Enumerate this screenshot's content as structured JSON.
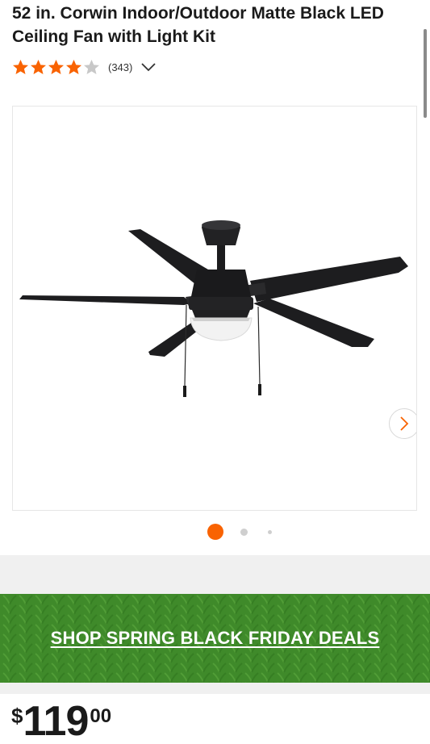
{
  "product": {
    "title": "52 in. Corwin Indoor/Outdoor Matte Black LED Ceiling Fan with Light Kit",
    "rating": 4,
    "max_rating": 5,
    "review_count": "(343)"
  },
  "gallery": {
    "active_slide": 1,
    "slide_count": 3,
    "image_icon": "ceiling-fan-product-image",
    "next_icon": "chevron-right-icon"
  },
  "promo": {
    "label": "SHOP SPRING BLACK FRIDAY DEALS",
    "background_color": "#3f8a2a"
  },
  "price": {
    "currency": "$",
    "dollars": "119",
    "cents": "00"
  },
  "colors": {
    "accent": "#f96302",
    "star_empty": "#c8c8c8"
  }
}
